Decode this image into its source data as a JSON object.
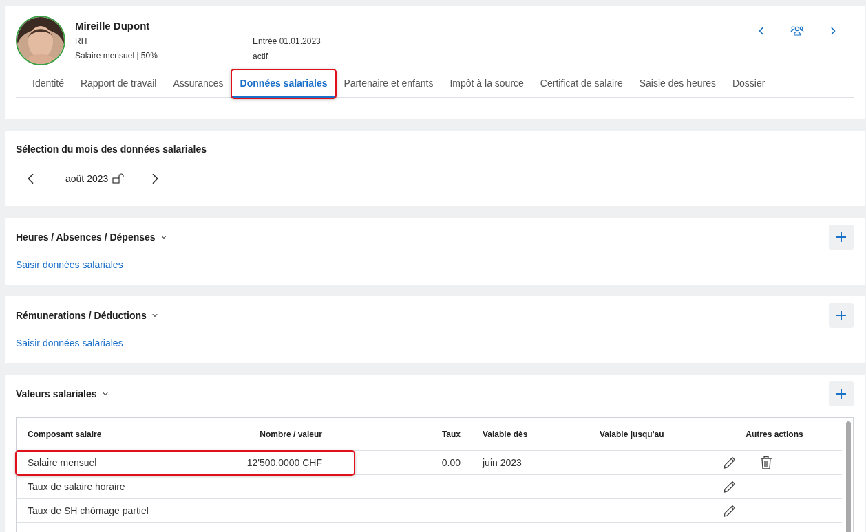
{
  "employee": {
    "name": "Mireille Dupont",
    "department": "RH",
    "salary_type": "Salaire mensuel | 50%",
    "entry": "Entrée 01.01.2023",
    "status": "actif"
  },
  "tabs": [
    {
      "label": "Identité",
      "selected": false,
      "highlighted": false
    },
    {
      "label": "Rapport de travail",
      "selected": false,
      "highlighted": false
    },
    {
      "label": "Assurances",
      "selected": false,
      "highlighted": false
    },
    {
      "label": "Données salariales",
      "selected": true,
      "highlighted": true
    },
    {
      "label": "Partenaire et enfants",
      "selected": false,
      "highlighted": false
    },
    {
      "label": "Impôt à la source",
      "selected": false,
      "highlighted": false
    },
    {
      "label": "Certificat de salaire",
      "selected": false,
      "highlighted": false
    },
    {
      "label": "Saisie des heures",
      "selected": false,
      "highlighted": false
    },
    {
      "label": "Dossier",
      "selected": false,
      "highlighted": false
    }
  ],
  "month_selection": {
    "title": "Sélection du mois des données salariales",
    "month": "août 2023"
  },
  "sections": [
    {
      "title": "Heures / Absences / Dépenses",
      "link": "Saisir données salariales"
    },
    {
      "title": "Rémunerations / Déductions",
      "link": "Saisir données salariales"
    }
  ],
  "salary_values": {
    "title": "Valeurs salariales",
    "columns": [
      "Composant salaire",
      "Nombre / valeur",
      "Taux",
      "Valable dès",
      "Valable jusqu'au",
      "Autres actions"
    ],
    "rows": [
      {
        "component": "Salaire mensuel",
        "value": "12'500.0000 CHF",
        "rate": "0.00",
        "valid_from": "juin 2023",
        "deletable": true,
        "highlighted": true
      },
      {
        "component": "Taux de salaire horaire",
        "deletable": false,
        "highlighted": false
      },
      {
        "component": "Taux de SH chômage partiel",
        "deletable": false,
        "highlighted": false
      }
    ]
  }
}
